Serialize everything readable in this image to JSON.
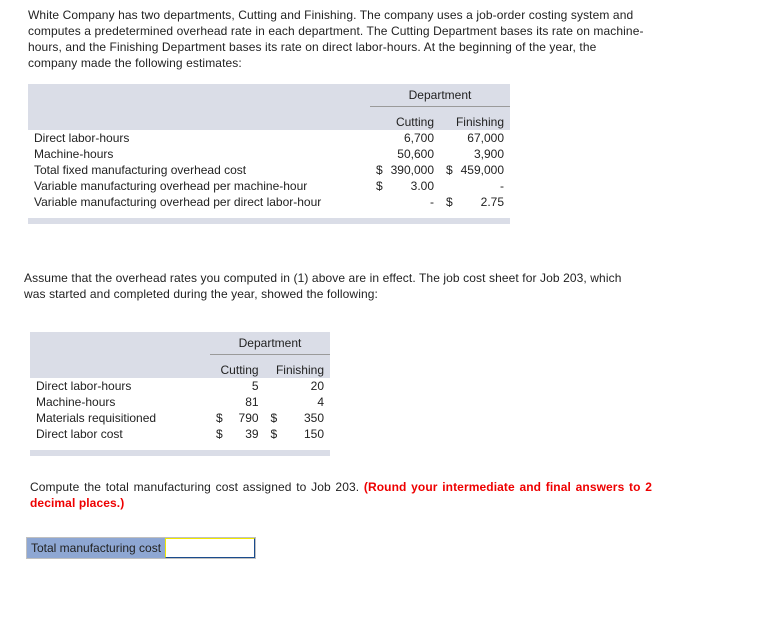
{
  "intro_text": "White Company has two departments, Cutting and Finishing. The company uses a job-order costing system and computes a predetermined overhead rate in each department. The Cutting Department bases its rate on machine-hours, and the Finishing Department bases its rate on direct labor-hours. At the beginning of the year, the company made the following estimates:",
  "estimates_table": {
    "group_header": "Department",
    "columns": [
      "Cutting",
      "Finishing"
    ],
    "rows": [
      {
        "label": "Direct labor-hours",
        "cutting_cur": "",
        "cutting": "6,700",
        "finishing_cur": "",
        "finishing": "67,000"
      },
      {
        "label": "Machine-hours",
        "cutting_cur": "",
        "cutting": "50,600",
        "finishing_cur": "",
        "finishing": "3,900"
      },
      {
        "label": "Total fixed manufacturing overhead cost",
        "cutting_cur": "$",
        "cutting": "390,000",
        "finishing_cur": "$",
        "finishing": "459,000"
      },
      {
        "label": "Variable manufacturing overhead per machine-hour",
        "cutting_cur": "$",
        "cutting": "3.00",
        "finishing_cur": "",
        "finishing": "-"
      },
      {
        "label": "Variable manufacturing overhead per direct labor-hour",
        "cutting_cur": "",
        "cutting": "-",
        "finishing_cur": "$",
        "finishing": "2.75"
      }
    ]
  },
  "assume_text": "Assume that the overhead rates you computed in (1) above are in effect. The job cost sheet for Job 203, which was started and completed during the year, showed the following:",
  "job_table": {
    "group_header": "Department",
    "columns": [
      "Cutting",
      "Finishing"
    ],
    "rows": [
      {
        "label": "Direct labor-hours",
        "cutting_cur": "",
        "cutting": "5",
        "finishing_cur": "",
        "finishing": "20"
      },
      {
        "label": "Machine-hours",
        "cutting_cur": "",
        "cutting": "81",
        "finishing_cur": "",
        "finishing": "4"
      },
      {
        "label": "Materials requisitioned",
        "cutting_cur": "$",
        "cutting": "790",
        "finishing_cur": "$",
        "finishing": "350"
      },
      {
        "label": "Direct labor cost",
        "cutting_cur": "$",
        "cutting": "39",
        "finishing_cur": "$",
        "finishing": "150"
      }
    ]
  },
  "compute_text": "Compute the total manufacturing cost assigned to Job 203.",
  "compute_instruction": "(Round your intermediate and final answers to 2 decimal places.)",
  "answer": {
    "label": "Total manufacturing cost",
    "value": ""
  }
}
